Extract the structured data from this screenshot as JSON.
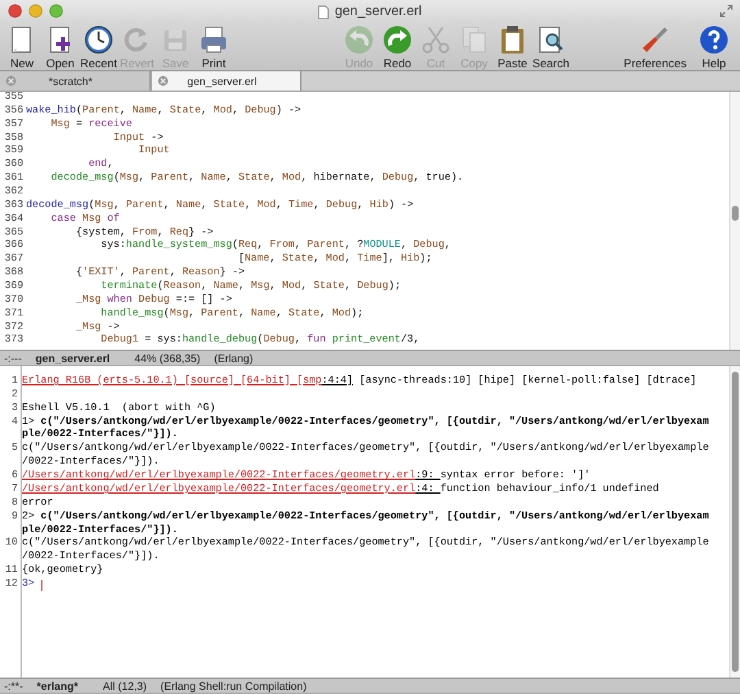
{
  "window": {
    "title": "gen_server.erl"
  },
  "toolbar": {
    "left": [
      {
        "label": "New",
        "disabled": false
      },
      {
        "label": "Open",
        "disabled": false
      },
      {
        "label": "Recent",
        "disabled": false
      },
      {
        "label": "Revert",
        "disabled": true
      },
      {
        "label": "Save",
        "disabled": true
      },
      {
        "label": "Print",
        "disabled": false
      }
    ],
    "middle": [
      {
        "label": "Undo",
        "disabled": true
      },
      {
        "label": "Redo",
        "disabled": false
      },
      {
        "label": "Cut",
        "disabled": true
      },
      {
        "label": "Copy",
        "disabled": true
      },
      {
        "label": "Paste",
        "disabled": false
      },
      {
        "label": "Search",
        "disabled": false
      }
    ],
    "right": [
      {
        "label": "Preferences",
        "disabled": false
      },
      {
        "label": "Help",
        "disabled": false
      }
    ]
  },
  "tabs": [
    {
      "label": "*scratch*",
      "selected": false
    },
    {
      "label": "gen_server.erl",
      "selected": true
    }
  ],
  "editor": {
    "lines": [
      {
        "number": "355"
      },
      {
        "number": "356",
        "code": [
          {
            "kind": "fn",
            "text": "wake_hib"
          },
          {
            "kind": "p",
            "text": "("
          },
          {
            "kind": "v",
            "text": "Parent"
          },
          {
            "kind": "p",
            "text": ", "
          },
          {
            "kind": "v",
            "text": "Name"
          },
          {
            "kind": "p",
            "text": ", "
          },
          {
            "kind": "v",
            "text": "State"
          },
          {
            "kind": "p",
            "text": ", "
          },
          {
            "kind": "v",
            "text": "Mod"
          },
          {
            "kind": "p",
            "text": ", "
          },
          {
            "kind": "v",
            "text": "Debug"
          },
          {
            "kind": "p",
            "text": ") ->"
          }
        ]
      },
      {
        "number": "357",
        "code": [
          {
            "kind": "v",
            "text": "    Msg"
          },
          {
            "kind": "p",
            "text": " = "
          },
          {
            "kind": "k",
            "text": "receive"
          }
        ]
      },
      {
        "number": "358",
        "code": [
          {
            "kind": "v",
            "text": "              Input"
          },
          {
            "kind": "p",
            "text": " ->"
          }
        ]
      },
      {
        "number": "359",
        "code": [
          {
            "kind": "v",
            "text": "                  Input"
          }
        ]
      },
      {
        "number": "360",
        "code": [
          {
            "kind": "k",
            "text": "          end"
          },
          {
            "kind": "p",
            "text": ","
          }
        ]
      },
      {
        "number": "361",
        "code": [
          {
            "kind": "c",
            "text": "    decode_msg"
          },
          {
            "kind": "p",
            "text": "("
          },
          {
            "kind": "v",
            "text": "Msg"
          },
          {
            "kind": "p",
            "text": ", "
          },
          {
            "kind": "v",
            "text": "Parent"
          },
          {
            "kind": "p",
            "text": ", "
          },
          {
            "kind": "v",
            "text": "Name"
          },
          {
            "kind": "p",
            "text": ", "
          },
          {
            "kind": "v",
            "text": "State"
          },
          {
            "kind": "p",
            "text": ", "
          },
          {
            "kind": "v",
            "text": "Mod"
          },
          {
            "kind": "p",
            "text": ", hibernate, "
          },
          {
            "kind": "v",
            "text": "Debug"
          },
          {
            "kind": "p",
            "text": ", true)."
          }
        ]
      },
      {
        "number": "362"
      },
      {
        "number": "363",
        "code": [
          {
            "kind": "fn",
            "text": "decode_msg"
          },
          {
            "kind": "p",
            "text": "("
          },
          {
            "kind": "v",
            "text": "Msg"
          },
          {
            "kind": "p",
            "text": ", "
          },
          {
            "kind": "v",
            "text": "Parent"
          },
          {
            "kind": "p",
            "text": ", "
          },
          {
            "kind": "v",
            "text": "Name"
          },
          {
            "kind": "p",
            "text": ", "
          },
          {
            "kind": "v",
            "text": "State"
          },
          {
            "kind": "p",
            "text": ", "
          },
          {
            "kind": "v",
            "text": "Mod"
          },
          {
            "kind": "p",
            "text": ", "
          },
          {
            "kind": "v",
            "text": "Time"
          },
          {
            "kind": "p",
            "text": ", "
          },
          {
            "kind": "v",
            "text": "Debug"
          },
          {
            "kind": "p",
            "text": ", "
          },
          {
            "kind": "v",
            "text": "Hib"
          },
          {
            "kind": "p",
            "text": ") ->"
          }
        ]
      },
      {
        "number": "364",
        "code": [
          {
            "kind": "k",
            "text": "    case "
          },
          {
            "kind": "v",
            "text": "Msg"
          },
          {
            "kind": "k",
            "text": " of"
          }
        ]
      },
      {
        "number": "365",
        "code": [
          {
            "kind": "p",
            "text": "        {system, "
          },
          {
            "kind": "v",
            "text": "From"
          },
          {
            "kind": "p",
            "text": ", "
          },
          {
            "kind": "v",
            "text": "Req"
          },
          {
            "kind": "p",
            "text": "} ->"
          }
        ]
      },
      {
        "number": "366",
        "code": [
          {
            "kind": "p",
            "text": "            sys:"
          },
          {
            "kind": "c",
            "text": "handle_system_msg"
          },
          {
            "kind": "p",
            "text": "("
          },
          {
            "kind": "v",
            "text": "Req"
          },
          {
            "kind": "p",
            "text": ", "
          },
          {
            "kind": "v",
            "text": "From"
          },
          {
            "kind": "p",
            "text": ", "
          },
          {
            "kind": "v",
            "text": "Parent"
          },
          {
            "kind": "p",
            "text": ", ?"
          },
          {
            "kind": "m",
            "text": "MODULE"
          },
          {
            "kind": "p",
            "text": ", "
          },
          {
            "kind": "v",
            "text": "Debug"
          },
          {
            "kind": "p",
            "text": ","
          }
        ]
      },
      {
        "number": "367",
        "code": [
          {
            "kind": "p",
            "text": "                                  ["
          },
          {
            "kind": "v",
            "text": "Name"
          },
          {
            "kind": "p",
            "text": ", "
          },
          {
            "kind": "v",
            "text": "State"
          },
          {
            "kind": "p",
            "text": ", "
          },
          {
            "kind": "v",
            "text": "Mod"
          },
          {
            "kind": "p",
            "text": ", "
          },
          {
            "kind": "v",
            "text": "Time"
          },
          {
            "kind": "p",
            "text": "], "
          },
          {
            "kind": "v",
            "text": "Hib"
          },
          {
            "kind": "p",
            "text": ");"
          }
        ]
      },
      {
        "number": "368",
        "code": [
          {
            "kind": "p",
            "text": "        {"
          },
          {
            "kind": "v",
            "text": "'EXIT'"
          },
          {
            "kind": "p",
            "text": ", "
          },
          {
            "kind": "v",
            "text": "Parent"
          },
          {
            "kind": "p",
            "text": ", "
          },
          {
            "kind": "v",
            "text": "Reason"
          },
          {
            "kind": "p",
            "text": "} ->"
          }
        ]
      },
      {
        "number": "369",
        "code": [
          {
            "kind": "c",
            "text": "            terminate"
          },
          {
            "kind": "p",
            "text": "("
          },
          {
            "kind": "v",
            "text": "Reason"
          },
          {
            "kind": "p",
            "text": ", "
          },
          {
            "kind": "v",
            "text": "Name"
          },
          {
            "kind": "p",
            "text": ", "
          },
          {
            "kind": "v",
            "text": "Msg"
          },
          {
            "kind": "p",
            "text": ", "
          },
          {
            "kind": "v",
            "text": "Mod"
          },
          {
            "kind": "p",
            "text": ", "
          },
          {
            "kind": "v",
            "text": "State"
          },
          {
            "kind": "p",
            "text": ", "
          },
          {
            "kind": "v",
            "text": "Debug"
          },
          {
            "kind": "p",
            "text": ");"
          }
        ]
      },
      {
        "number": "370",
        "code": [
          {
            "kind": "v",
            "text": "        _Msg"
          },
          {
            "kind": "k",
            "text": " when "
          },
          {
            "kind": "v",
            "text": "Debug"
          },
          {
            "kind": "p",
            "text": " =:= [] ->"
          }
        ]
      },
      {
        "number": "371",
        "code": [
          {
            "kind": "c",
            "text": "            handle_msg"
          },
          {
            "kind": "p",
            "text": "("
          },
          {
            "kind": "v",
            "text": "Msg"
          },
          {
            "kind": "p",
            "text": ", "
          },
          {
            "kind": "v",
            "text": "Parent"
          },
          {
            "kind": "p",
            "text": ", "
          },
          {
            "kind": "v",
            "text": "Name"
          },
          {
            "kind": "p",
            "text": ", "
          },
          {
            "kind": "v",
            "text": "State"
          },
          {
            "kind": "p",
            "text": ", "
          },
          {
            "kind": "v",
            "text": "Mod"
          },
          {
            "kind": "p",
            "text": ");"
          }
        ]
      },
      {
        "number": "372",
        "code": [
          {
            "kind": "v",
            "text": "        _Msg"
          },
          {
            "kind": "p",
            "text": " ->"
          }
        ]
      },
      {
        "number": "373",
        "code": [
          {
            "kind": "v",
            "text": "            Debug1"
          },
          {
            "kind": "p",
            "text": " = sys:"
          },
          {
            "kind": "c",
            "text": "handle_debug"
          },
          {
            "kind": "p",
            "text": "("
          },
          {
            "kind": "v",
            "text": "Debug"
          },
          {
            "kind": "p",
            "text": ", "
          },
          {
            "kind": "k",
            "text": "fun"
          },
          {
            "kind": "c",
            "text": " print_event"
          },
          {
            "kind": "p",
            "text": "/3,"
          }
        ]
      }
    ]
  },
  "editor_mode_line": {
    "flags": "-:---",
    "buffer": "gen_server.erl",
    "position": "44% (368,35)",
    "mode": "(Erlang)"
  },
  "shell": {
    "lines": [
      {
        "number": "1",
        "rows": [
          [
            {
              "kind": "err",
              "text": "Erlang R16B (erts-5.10.1) [source] [64-bit] [smp"
            },
            {
              "kind": "link",
              "text": ":4:4]"
            },
            {
              "kind": "plain",
              "text": " [async-threads:10] [hipe] [kernel-poll:false] [dtrace]"
            }
          ]
        ]
      },
      {
        "number": "2"
      },
      {
        "number": "3",
        "rows": [
          [
            {
              "kind": "plain",
              "text": "Eshell V5.10.1  (abort with ^G)"
            }
          ]
        ]
      },
      {
        "number": "4",
        "rows": [
          [
            {
              "kind": "plain",
              "text": "1> "
            },
            {
              "kind": "bold",
              "text": "c(\"/Users/antkong/wd/erl/erlbyexample/0022-Interfaces/geometry\", [{outdir, \"/Users/antkong/wd/erl/erlbyexam"
            }
          ],
          [
            {
              "kind": "bold",
              "text": "ple/0022-Interfaces/\"}])."
            }
          ]
        ]
      },
      {
        "number": "5",
        "rows": [
          [
            {
              "kind": "plain",
              "text": "c(\"/Users/antkong/wd/erl/erlbyexample/0022-Interfaces/geometry\", [{outdir, \"/Users/antkong/wd/erl/erlbyexample"
            }
          ],
          [
            {
              "kind": "plain",
              "text": "/0022-Interfaces/\"}])."
            }
          ]
        ]
      },
      {
        "number": "6",
        "rows": [
          [
            {
              "kind": "err",
              "text": "/Users/antkong/wd/erl/erlbyexample/0022-Interfaces/geometry.erl"
            },
            {
              "kind": "link",
              "text": ":9: "
            },
            {
              "kind": "plain",
              "text": "syntax error before: ']'"
            }
          ]
        ]
      },
      {
        "number": "7",
        "rows": [
          [
            {
              "kind": "err",
              "text": "/Users/antkong/wd/erl/erlbyexample/0022-Interfaces/geometry.erl"
            },
            {
              "kind": "link",
              "text": ":4: "
            },
            {
              "kind": "plain",
              "text": "function behaviour_info/1 undefined"
            }
          ]
        ]
      },
      {
        "number": "8",
        "rows": [
          [
            {
              "kind": "plain",
              "text": "error"
            }
          ]
        ]
      },
      {
        "number": "9",
        "rows": [
          [
            {
              "kind": "plain",
              "text": "2> "
            },
            {
              "kind": "bold",
              "text": "c(\"/Users/antkong/wd/erl/erlbyexample/0022-Interfaces/geometry\", [{outdir, \"/Users/antkong/wd/erl/erlbyexam"
            }
          ],
          [
            {
              "kind": "bold",
              "text": "ple/0022-Interfaces/\"}])."
            }
          ]
        ]
      },
      {
        "number": "10",
        "rows": [
          [
            {
              "kind": "plain",
              "text": "c(\"/Users/antkong/wd/erl/erlbyexample/0022-Interfaces/geometry\", [{outdir, \"/Users/antkong/wd/erl/erlbyexample"
            }
          ],
          [
            {
              "kind": "plain",
              "text": "/0022-Interfaces/\"}])."
            }
          ]
        ]
      },
      {
        "number": "11",
        "rows": [
          [
            {
              "kind": "plain",
              "text": "{ok,geometry}"
            }
          ]
        ]
      },
      {
        "number": "12",
        "rows": [
          [
            {
              "kind": "prompt",
              "text": "3> "
            }
          ]
        ]
      }
    ]
  },
  "shell_mode_line": {
    "flags": "-:**-",
    "buffer": "*erlang*",
    "position": "All (12,3)",
    "mode": "(Erlang Shell:run Compilation)"
  }
}
